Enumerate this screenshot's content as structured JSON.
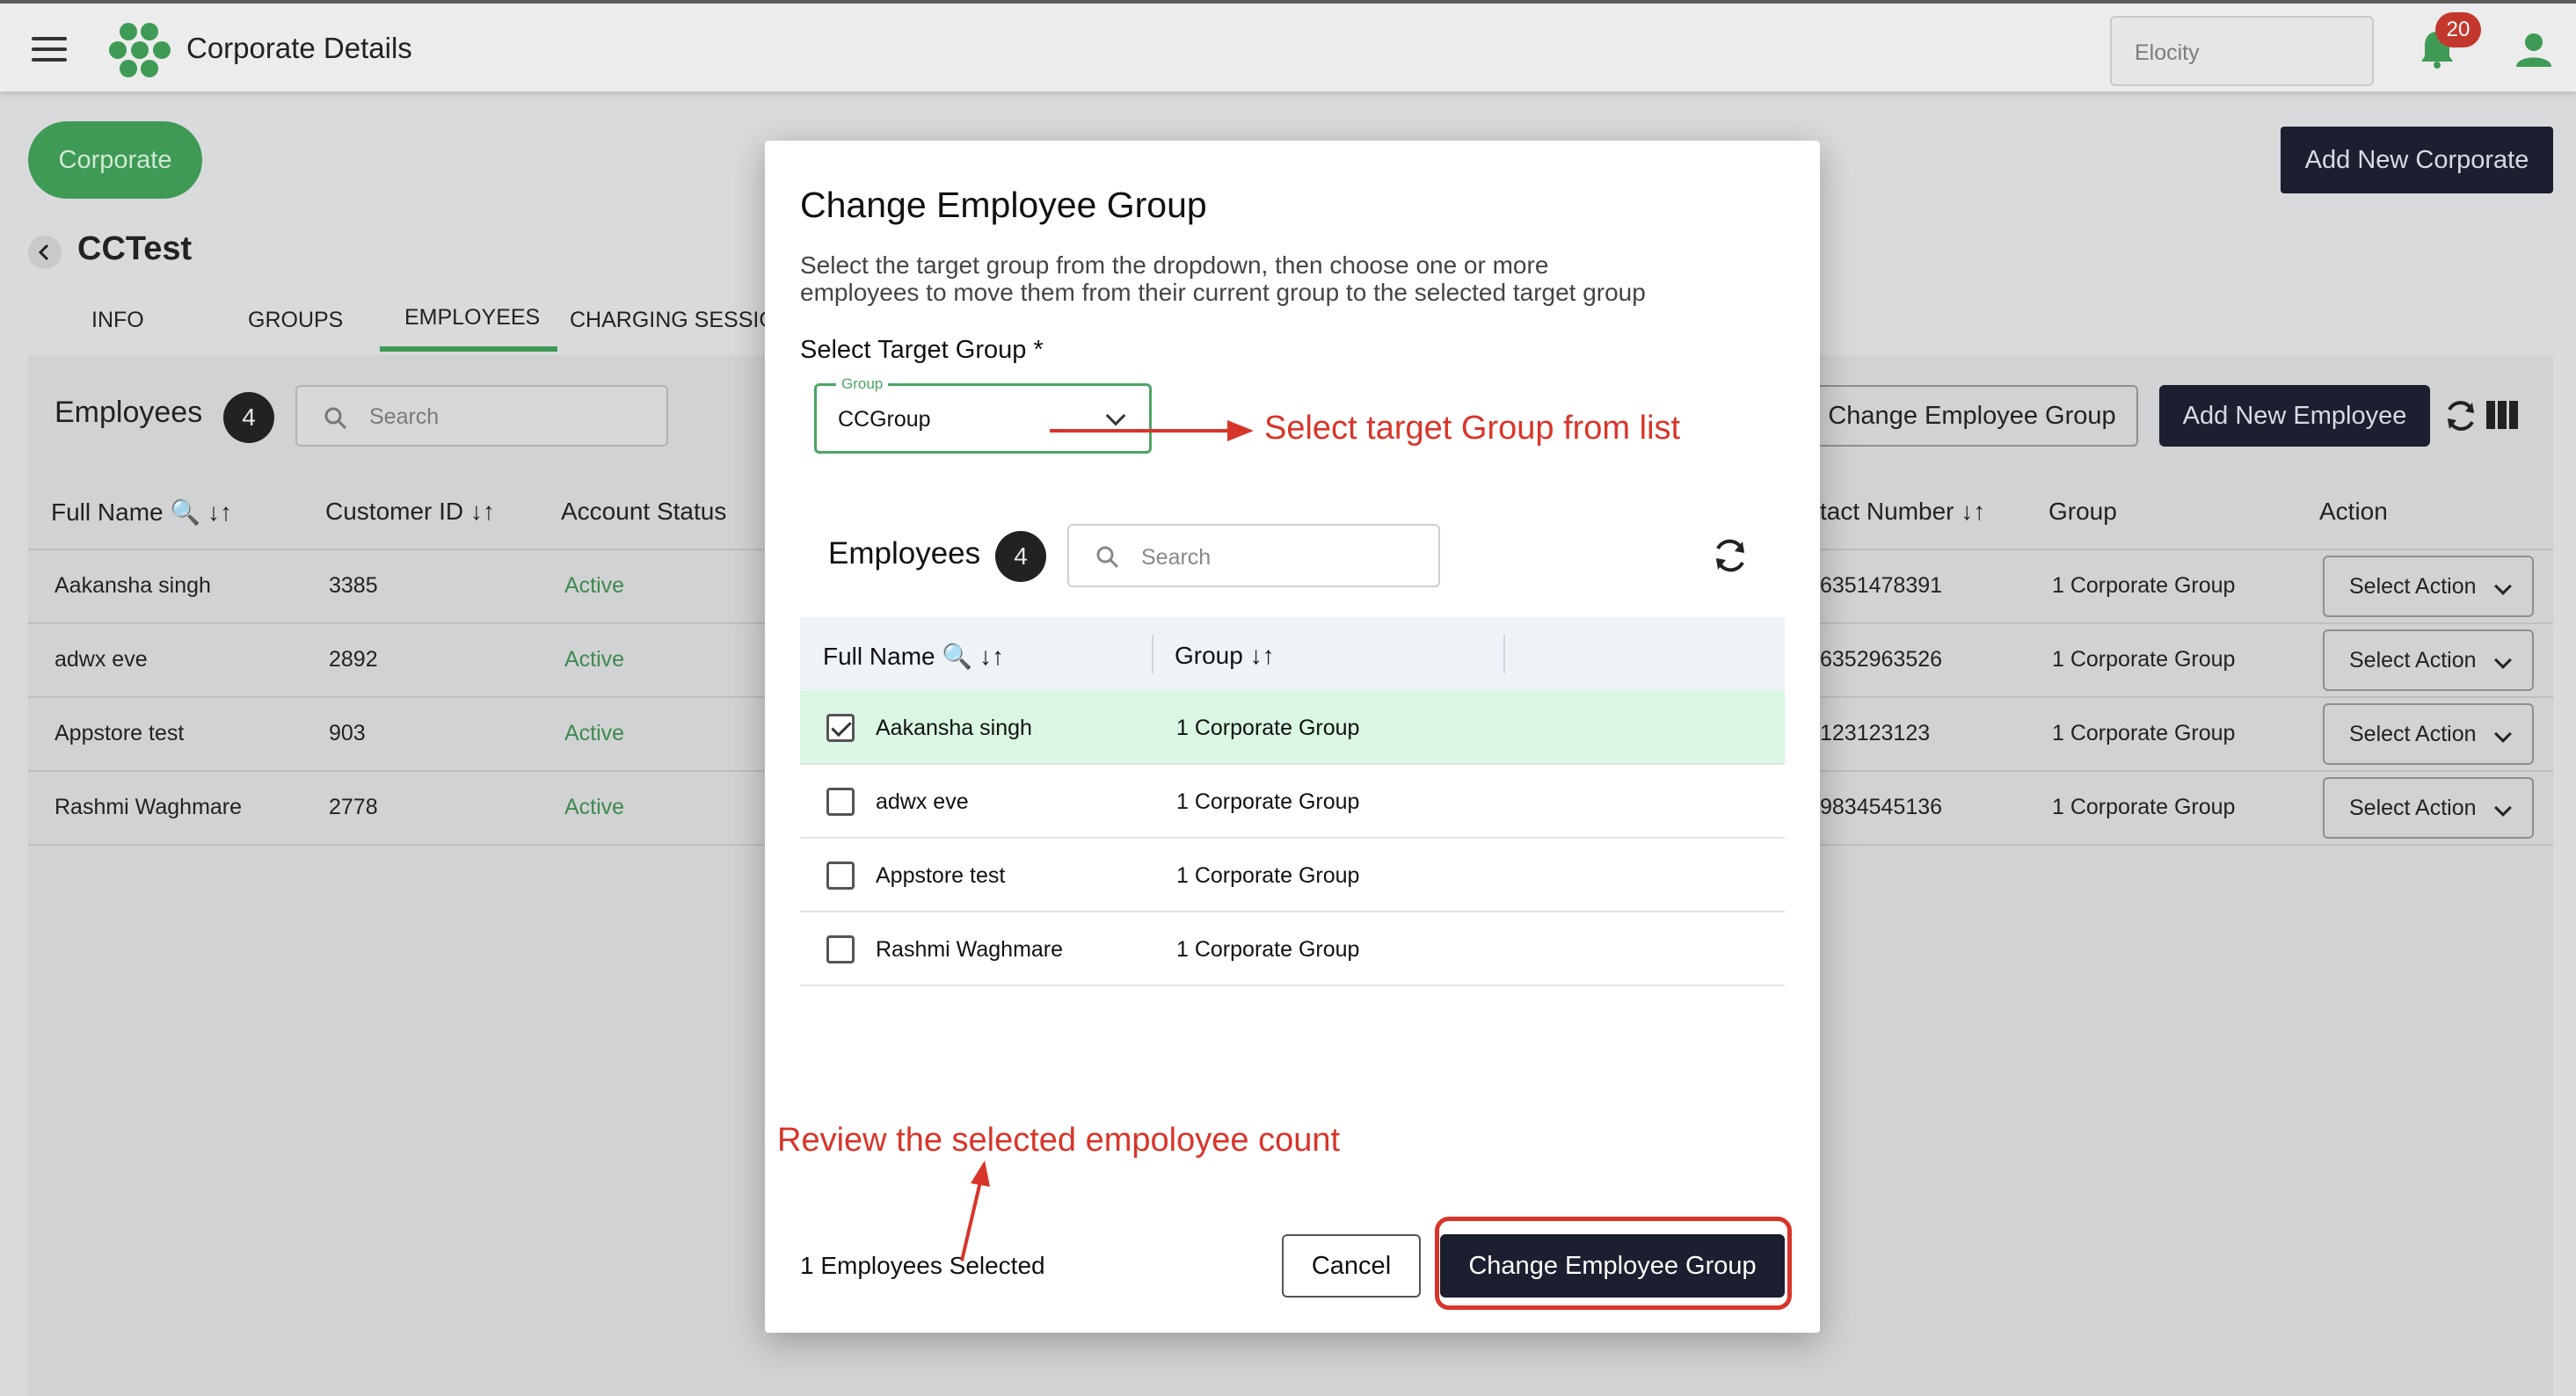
{
  "app": {
    "title": "Corporate Details",
    "org_selector_value": "Elocity",
    "notification_count": "20"
  },
  "header": {
    "corporate_pill": "Corporate",
    "add_corporate_label": "Add New Corporate",
    "corporate_name": "CCTest"
  },
  "tabs": [
    {
      "label": "INFO",
      "active": false
    },
    {
      "label": "GROUPS",
      "active": false
    },
    {
      "label": "EMPLOYEES",
      "active": true
    },
    {
      "label": "CHARGING SESSIO",
      "active": false
    }
  ],
  "employees_panel": {
    "title": "Employees",
    "count": "4",
    "search_placeholder": "Search",
    "change_group_label": "Change Employee Group",
    "add_employee_label": "Add New Employee",
    "columns": [
      "Full Name",
      "Customer ID",
      "Account Status",
      "tact Number",
      "Group",
      "Action"
    ],
    "rows": [
      {
        "name": "Aakansha singh",
        "customer_id": "3385",
        "status": "Active",
        "contact": "6351478391",
        "group": "1 Corporate Group",
        "action": "Select Action"
      },
      {
        "name": "adwx eve",
        "customer_id": "2892",
        "status": "Active",
        "contact": "6352963526",
        "group": "1 Corporate Group",
        "action": "Select Action"
      },
      {
        "name": "Appstore test",
        "customer_id": "903",
        "status": "Active",
        "contact": "123123123",
        "group": "1 Corporate Group",
        "action": "Select Action"
      },
      {
        "name": "Rashmi Waghmare",
        "customer_id": "2778",
        "status": "Active",
        "contact": "9834545136",
        "group": "1 Corporate Group",
        "action": "Select Action"
      }
    ]
  },
  "modal": {
    "title": "Change Employee Group",
    "description": "Select the target group from the dropdown, then choose one or more employees to move them from their current group to the selected target group",
    "target_label": "Select Target Group *",
    "group_field_legend": "Group",
    "group_value": "CCGroup",
    "employees_title": "Employees",
    "employees_count": "4",
    "search_placeholder": "Search",
    "columns": [
      "Full Name",
      "Group"
    ],
    "rows": [
      {
        "name": "Aakansha singh",
        "group": "1 Corporate Group",
        "checked": true
      },
      {
        "name": "adwx eve",
        "group": "1 Corporate Group",
        "checked": false
      },
      {
        "name": "Appstore test",
        "group": "1 Corporate Group",
        "checked": false
      },
      {
        "name": "Rashmi Waghmare",
        "group": "1 Corporate Group",
        "checked": false
      }
    ],
    "selected_count_text": "1 Employees Selected",
    "cancel_label": "Cancel",
    "confirm_label": "Change Employee Group"
  },
  "annotations": {
    "select_group": "Select target Group from list",
    "review_count": "Review the selected empoloyee count"
  },
  "colors": {
    "accent_green": "#3e9a55",
    "dark_navy": "#1b1f2f",
    "annotation_red": "#d8352a",
    "selected_row": "#d9f7e3"
  }
}
